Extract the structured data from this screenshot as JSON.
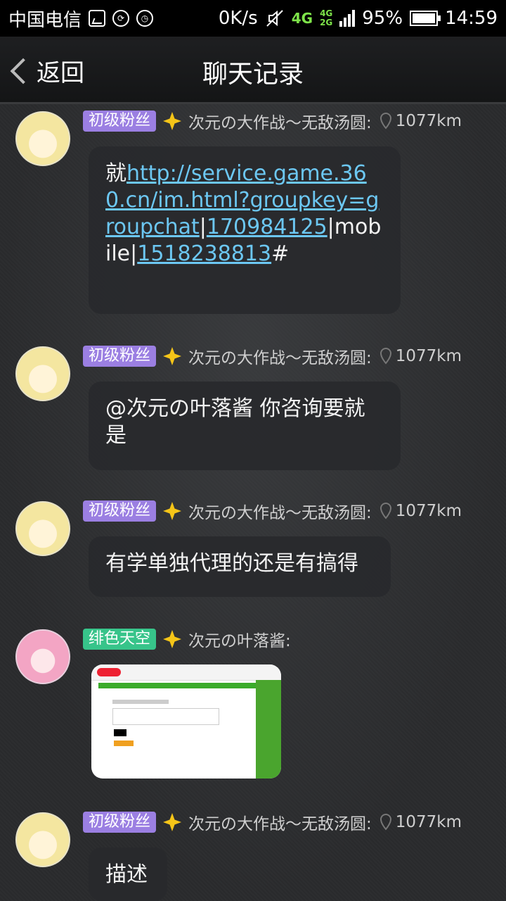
{
  "status_bar": {
    "carrier": "中国电信",
    "speed": "0K/s",
    "net_primary": "4G",
    "net_secondary_top": "4G",
    "net_secondary_bottom": "2G",
    "battery": "95%",
    "time": "14:59"
  },
  "header": {
    "back_label": "返回",
    "title": "聊天记录"
  },
  "messages": [
    {
      "badge": "初级粉丝",
      "sender": "次元の大作战～无敌汤圆:",
      "distance": "1077km",
      "text_prefix": "就",
      "link_url": "http://service.game.360.cn/im.html?groupkey=groupchat",
      "sep1": "|",
      "link_id1": "170984125",
      "mid_text": "|mobile|",
      "link_id2": "1518238813",
      "suffix": "#"
    },
    {
      "badge": "初级粉丝",
      "sender": "次元の大作战～无敌汤圆:",
      "distance": "1077km",
      "text": "@次元の叶落酱 你咨询要就是"
    },
    {
      "badge": "初级粉丝",
      "sender": "次元の大作战～无敌汤圆:",
      "distance": "1077km",
      "text": "有学单独代理的还是有搞得"
    },
    {
      "badge": "绯色天空",
      "sender": "次元の叶落酱:",
      "image": "screenshot-thumbnail"
    },
    {
      "badge": "初级粉丝",
      "sender": "次元の大作战～无敌汤圆:",
      "distance": "1077km",
      "text": "描述"
    }
  ],
  "colors": {
    "badge_purple": "#9b7fe2",
    "badge_green": "#37c48a",
    "link": "#6cc7f2",
    "net_green": "#7ee34a"
  }
}
